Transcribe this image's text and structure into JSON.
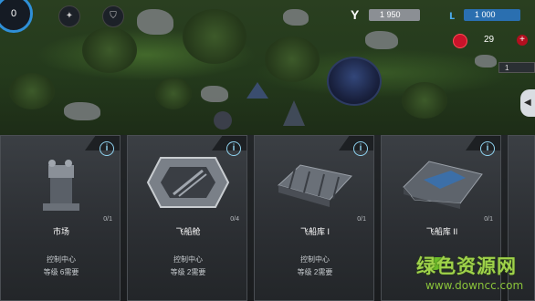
{
  "hud": {
    "level": "0",
    "resource_primary": {
      "icon": "tech-y-icon",
      "value": "1 950"
    },
    "resource_secondary": {
      "icon": "energy-icon",
      "value": "1 000"
    },
    "gems": {
      "value": "29",
      "plus": "+"
    },
    "side_box": "1",
    "side_tab": "◀"
  },
  "cards": [
    {
      "name": "市场",
      "count": "0/1",
      "req_line1": "控制中心",
      "req_line2": "等级 6需要",
      "info": "i"
    },
    {
      "name": "飞船舱",
      "count": "0/4",
      "req_line1": "控制中心",
      "req_line2": "等级 2需要",
      "info": "i"
    },
    {
      "name": "飞船库 I",
      "count": "0/1",
      "req_line1": "控制中心",
      "req_line2": "等级 2需要",
      "info": "i"
    },
    {
      "name": "飞船库 II",
      "count": "0/1",
      "req_line1": "",
      "req_line2": "",
      "info": "i"
    }
  ],
  "watermark": {
    "title": "绿色资源网",
    "url": "www.downcc.com"
  },
  "colors": {
    "accent_blue": "#2f8fd8",
    "gem_red": "#c9132a",
    "info_cyan": "#8fd3f0",
    "watermark_green": "#9fd24a"
  }
}
